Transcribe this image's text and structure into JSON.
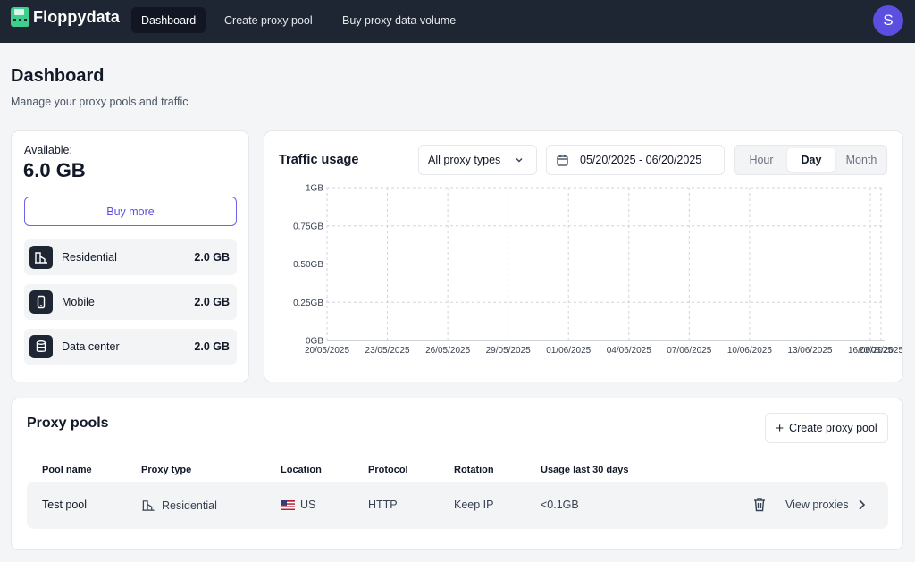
{
  "app": {
    "name": "Floppydata",
    "avatar_initial": "S",
    "accent": "#5a4fe0"
  },
  "nav": {
    "items": [
      {
        "label": "Dashboard",
        "active": true
      },
      {
        "label": "Create proxy pool",
        "active": false
      },
      {
        "label": "Buy proxy data volume",
        "active": false
      }
    ]
  },
  "header": {
    "title": "Dashboard",
    "subtitle": "Manage your proxy pools and traffic"
  },
  "available": {
    "label": "Available:",
    "value": "6.0 GB",
    "buy_more": "Buy more",
    "types": [
      {
        "name": "Residential",
        "value": "2.0 GB",
        "icon": "residential-icon"
      },
      {
        "name": "Mobile",
        "value": "2.0 GB",
        "icon": "mobile-icon"
      },
      {
        "name": "Data center",
        "value": "2.0 GB",
        "icon": "database-icon"
      }
    ]
  },
  "traffic": {
    "title": "Traffic usage",
    "proxy_type_select": "All proxy types",
    "date_range": "05/20/2025 - 06/20/2025",
    "granularity": [
      {
        "label": "Hour",
        "active": false
      },
      {
        "label": "Day",
        "active": true
      },
      {
        "label": "Month",
        "active": false
      }
    ]
  },
  "chart_data": {
    "type": "line",
    "title": "Traffic usage",
    "xlabel": "",
    "ylabel": "",
    "x_ticks": [
      "20/05/2025",
      "23/05/2025",
      "26/05/2025",
      "29/05/2025",
      "01/06/2025",
      "04/06/2025",
      "07/06/2025",
      "10/06/2025",
      "13/06/2025",
      "16/06/2025",
      "20/06/2025"
    ],
    "y_ticks": [
      "0GB",
      "0.25GB",
      "0.50GB",
      "0.75GB",
      "1GB"
    ],
    "ylim": [
      0,
      1
    ],
    "series": [],
    "grid": true,
    "grid_style": "dashed"
  },
  "pools": {
    "title": "Proxy pools",
    "create_button": "Create proxy pool",
    "columns": [
      "Pool name",
      "Proxy type",
      "Location",
      "Protocol",
      "Rotation",
      "Usage last 30 days"
    ],
    "rows": [
      {
        "name": "Test pool",
        "type": "Residential",
        "location": "US",
        "protocol": "HTTP",
        "rotation": "Keep IP",
        "usage": "<0.1GB",
        "view_label": "View proxies"
      }
    ]
  }
}
